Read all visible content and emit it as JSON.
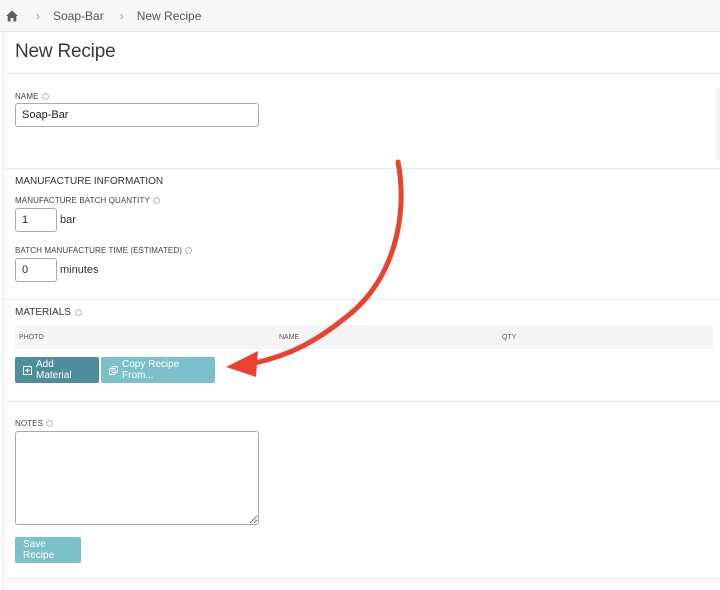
{
  "breadcrumb": {
    "items": [
      "Soap-Bar",
      "New Recipe"
    ]
  },
  "page": {
    "title": "New Recipe"
  },
  "name_field": {
    "label": "NAME",
    "value": "Soap-Bar"
  },
  "manufacture": {
    "heading": "MANUFACTURE INFORMATION",
    "batch_qty_label": "MANUFACTURE BATCH QUANTITY",
    "batch_qty_value": "1",
    "batch_qty_unit": "bar",
    "batch_time_label": "BATCH MANUFACTURE TIME (ESTIMATED)",
    "batch_time_value": "0",
    "batch_time_unit": "minutes"
  },
  "materials": {
    "heading": "MATERIALS",
    "columns": [
      "PHOTO",
      "NAME",
      "QTY"
    ],
    "add_button": "Add Material",
    "copy_button": "Copy Recipe From..."
  },
  "notes": {
    "label": "NOTES",
    "value": ""
  },
  "save_button": "Save Recipe",
  "colors": {
    "accent_dark": "#4e8e9a",
    "accent_light": "#7cc0ca",
    "annotation_arrow": "#e8432f"
  },
  "icons": [
    "home-icon",
    "chevron-right-icon",
    "help-icon",
    "plus-square-icon",
    "copy-icon",
    "curved-arrow-annotation"
  ]
}
